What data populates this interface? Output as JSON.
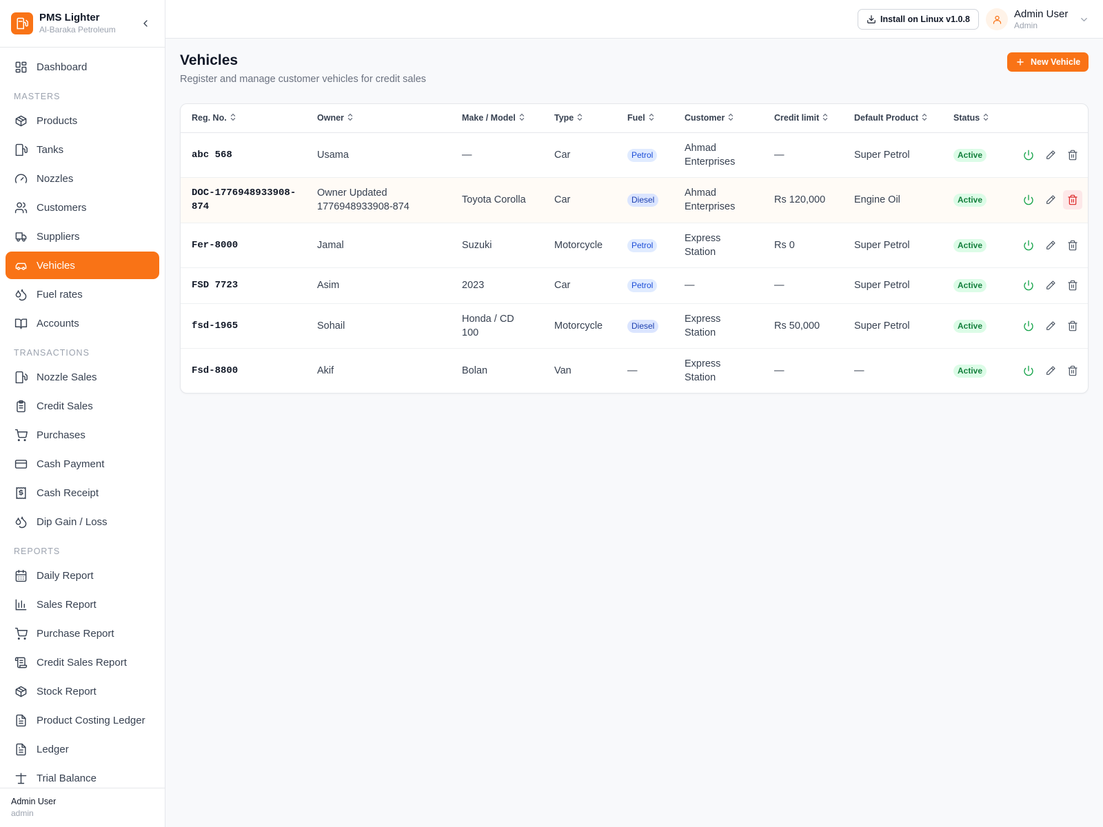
{
  "brand": {
    "name": "PMS Lighter",
    "subtitle": "Al-Baraka Petroleum"
  },
  "sidebar": {
    "dashboard": "Dashboard",
    "sections": {
      "masters": "MASTERS",
      "transactions": "TRANSACTIONS",
      "reports": "REPORTS"
    },
    "masters": [
      "Products",
      "Tanks",
      "Nozzles",
      "Customers",
      "Suppliers",
      "Vehicles",
      "Fuel rates",
      "Accounts"
    ],
    "transactions": [
      "Nozzle Sales",
      "Credit Sales",
      "Purchases",
      "Cash Payment",
      "Cash Receipt",
      "Dip Gain / Loss"
    ],
    "reports": [
      "Daily Report",
      "Sales Report",
      "Purchase Report",
      "Credit Sales Report",
      "Stock Report",
      "Product Costing Ledger",
      "Ledger",
      "Trial Balance"
    ],
    "active_item": "Vehicles",
    "footer": {
      "name": "Admin User",
      "role": "admin"
    }
  },
  "header": {
    "install_label": "Install on Linux v1.0.8",
    "user_name": "Admin User",
    "user_role": "Admin"
  },
  "page": {
    "title": "Vehicles",
    "subtitle": "Register and manage customer vehicles for credit sales",
    "new_button": "New Vehicle"
  },
  "table": {
    "columns": [
      "Reg. No.",
      "Owner",
      "Make / Model",
      "Type",
      "Fuel",
      "Customer",
      "Credit limit",
      "Default Product",
      "Status"
    ],
    "rows": [
      {
        "reg": "abc 568",
        "owner": "Usama",
        "make": "—",
        "type": "Car",
        "fuel": "Petrol",
        "customer": "Ahmad Enterprises",
        "credit": "—",
        "product": "Super Petrol",
        "status": "Active"
      },
      {
        "reg": "DOC-1776948933908-874",
        "owner": "Owner Updated 1776948933908-874",
        "make": "Toyota Corolla",
        "type": "Car",
        "fuel": "Diesel",
        "customer": "Ahmad Enterprises",
        "credit": "Rs 120,000",
        "product": "Engine Oil",
        "status": "Active"
      },
      {
        "reg": "Fer-8000",
        "owner": "Jamal",
        "make": "Suzuki",
        "type": "Motorcycle",
        "fuel": "Petrol",
        "customer": "Express Station",
        "credit": "Rs 0",
        "product": "Super Petrol",
        "status": "Active"
      },
      {
        "reg": "FSD 7723",
        "owner": "Asim",
        "make": "2023",
        "type": "Car",
        "fuel": "Petrol",
        "customer": "—",
        "credit": "—",
        "product": "Super Petrol",
        "status": "Active"
      },
      {
        "reg": "fsd-1965",
        "owner": "Sohail",
        "make": "Honda / CD 100",
        "type": "Motorcycle",
        "fuel": "Diesel",
        "customer": "Express Station",
        "credit": "Rs 50,000",
        "product": "Super Petrol",
        "status": "Active"
      },
      {
        "reg": "Fsd-8800",
        "owner": "Akif",
        "make": "Bolan",
        "type": "Van",
        "fuel": "—",
        "customer": "Express Station",
        "credit": "—",
        "product": "—",
        "status": "Active"
      }
    ]
  },
  "colors": {
    "accent": "#f97316",
    "active_green": "#16a34a",
    "delete_red": "#dc2626"
  }
}
